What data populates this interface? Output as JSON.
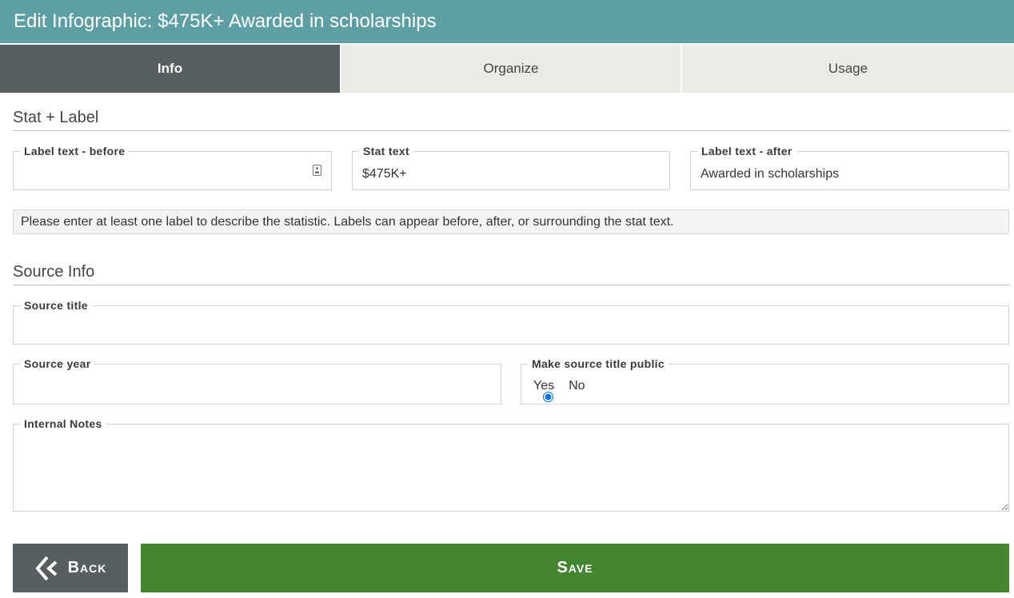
{
  "header": {
    "title": "Edit Infographic: $475K+ Awarded in scholarships"
  },
  "tabs": [
    {
      "label": "Info",
      "active": true
    },
    {
      "label": "Organize",
      "active": false
    },
    {
      "label": "Usage",
      "active": false
    }
  ],
  "stat_section": {
    "title": "Stat + Label",
    "label_before": {
      "legend": "Label text - before",
      "value": ""
    },
    "stat_text": {
      "legend": "Stat text",
      "value": "$475K+"
    },
    "label_after": {
      "legend": "Label text - after",
      "value": "Awarded in scholarships"
    },
    "help": "Please enter at least one label to describe the statistic. Labels can appear before, after, or surrounding the stat text."
  },
  "source_section": {
    "title": "Source Info",
    "source_title": {
      "legend": "Source title",
      "value": ""
    },
    "source_year": {
      "legend": "Source year",
      "value": ""
    },
    "make_public": {
      "legend": "Make source title public",
      "options": [
        "Yes",
        "No"
      ],
      "selected": "No"
    },
    "internal_notes": {
      "legend": "Internal Notes",
      "value": ""
    }
  },
  "buttons": {
    "back_label": "Back",
    "save_label": "Save"
  },
  "icons": {
    "back": "double-chevron-left-icon",
    "contact": "contact-card-icon"
  },
  "colors": {
    "header_bg": "#5e9fa4",
    "active_tab_bg": "#575f61",
    "inactive_tab_bg": "#ebebe6",
    "save_bg": "#43862f",
    "back_bg": "#575f61"
  }
}
